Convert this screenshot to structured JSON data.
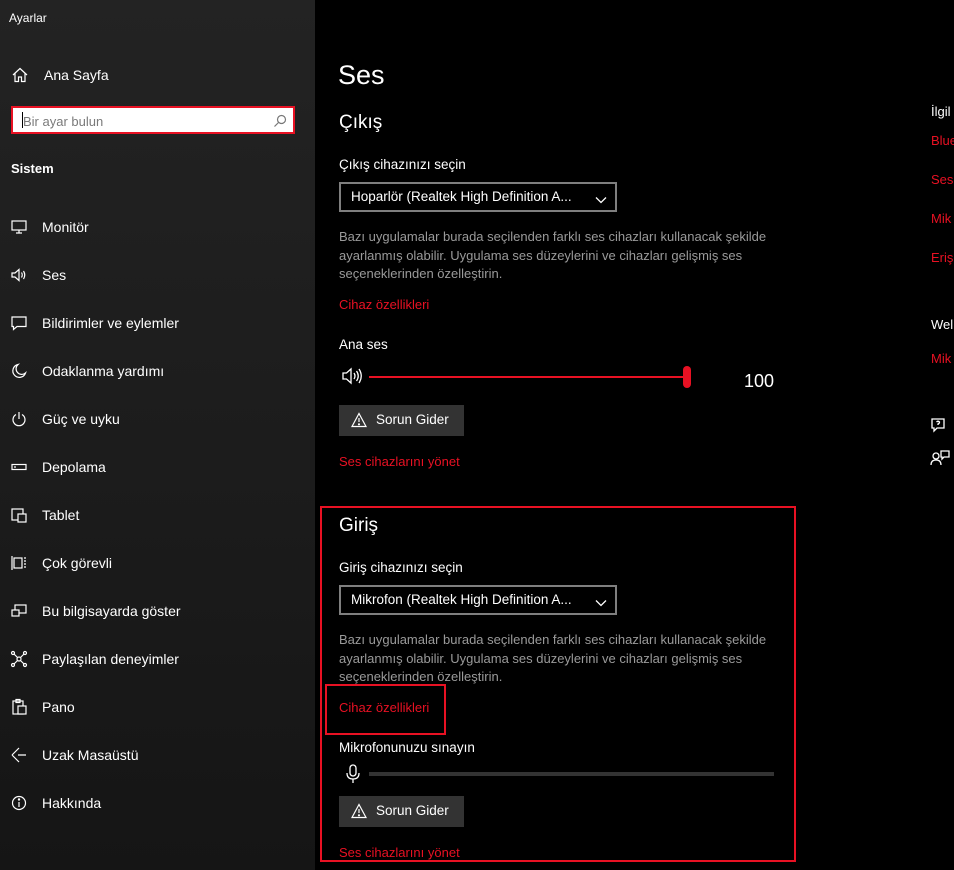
{
  "window": {
    "title": "Ayarlar"
  },
  "sidebar": {
    "home_label": "Ana Sayfa",
    "search_placeholder": "Bir ayar bulun",
    "section": "Sistem",
    "items": [
      {
        "label": "Monitör",
        "icon": "monitor-icon"
      },
      {
        "label": "Ses",
        "icon": "speaker-icon"
      },
      {
        "label": "Bildirimler ve eylemler",
        "icon": "notification-icon"
      },
      {
        "label": "Odaklanma yardımı",
        "icon": "moon-icon"
      },
      {
        "label": "Güç ve uyku",
        "icon": "power-icon"
      },
      {
        "label": "Depolama",
        "icon": "storage-icon"
      },
      {
        "label": "Tablet",
        "icon": "tablet-icon"
      },
      {
        "label": "Çok görevli",
        "icon": "multitask-icon"
      },
      {
        "label": "Bu bilgisayarda göster",
        "icon": "project-icon"
      },
      {
        "label": "Paylaşılan deneyimler",
        "icon": "shared-icon"
      },
      {
        "label": "Pano",
        "icon": "clipboard-icon"
      },
      {
        "label": "Uzak Masaüstü",
        "icon": "remote-desktop-icon"
      },
      {
        "label": "Hakkında",
        "icon": "info-icon"
      }
    ]
  },
  "main": {
    "title": "Ses",
    "output": {
      "heading": "Çıkış",
      "select_label": "Çıkış cihazınızı seçin",
      "device": "Hoparlör (Realtek High Definition A...",
      "desc": "Bazı uygulamalar burada seçilenden farklı ses cihazları kullanacak şekilde ayarlanmış olabilir. Uygulama ses düzeylerini ve cihazları gelişmiş ses seçeneklerinden özelleştirin.",
      "device_props_link": "Cihaz özellikleri",
      "volume_label": "Ana ses",
      "volume_value": "100",
      "volume_fraction": 1.0,
      "troubleshoot": "Sorun Gider",
      "manage_link": "Ses cihazlarını yönet"
    },
    "input": {
      "heading": "Giriş",
      "select_label": "Giriş cihazınızı seçin",
      "device": "Mikrofon (Realtek High Definition A...",
      "desc": "Bazı uygulamalar burada seçilenden farklı ses cihazları kullanacak şekilde ayarlanmış olabilir. Uygulama ses düzeylerini ve cihazları gelişmiş ses seçeneklerinden özelleştirin.",
      "device_props_link": "Cihaz özellikleri",
      "test_label": "Mikrofonunuzu sınayın",
      "mic_level_fraction": 0,
      "troubleshoot": "Sorun Gider",
      "manage_link": "Ses cihazlarını yönet"
    },
    "related": {
      "heading": "İlgil",
      "links": [
        "Blue",
        "Ses",
        "Mik",
        "Eriş"
      ],
      "web_heading": "Wel",
      "web_link": "Mik"
    }
  },
  "colors": {
    "accent": "#e81123",
    "sidebar_bg": "#1f1f1f",
    "main_bg": "#000000",
    "button_bg": "#333333"
  }
}
